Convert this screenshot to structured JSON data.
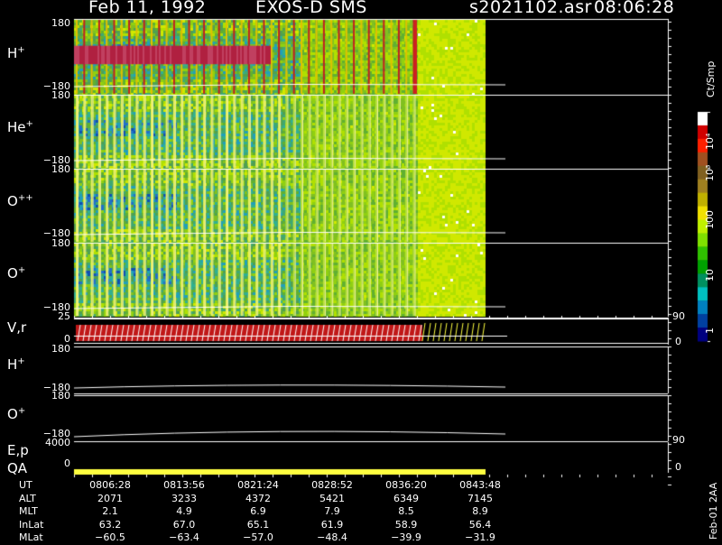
{
  "header": {
    "date": "Feb 11, 1992",
    "mission": "EXOS-D SMS",
    "file": "s2021102.asr",
    "time": "08:06:28"
  },
  "panels": [
    {
      "id": "h",
      "label": "H",
      "sup": "+",
      "top_tick": "180",
      "bottom_tick": "−180"
    },
    {
      "id": "he",
      "label": "He",
      "sup": "+",
      "top_tick": "180",
      "bottom_tick": "−180"
    },
    {
      "id": "opp",
      "label": "O",
      "sup": "++",
      "top_tick": "180",
      "bottom_tick": "−180"
    },
    {
      "id": "o",
      "label": "O",
      "sup": "+",
      "top_tick": "180",
      "bottom_tick": "−180"
    }
  ],
  "vr_panel": {
    "label": "V,r",
    "top_tick": "25",
    "bottom_tick": "0",
    "right_top": "90",
    "right_bottom": "0"
  },
  "h_line_panel": {
    "label": "H",
    "sup": "+",
    "top_tick": "180",
    "bottom_tick": "−180"
  },
  "o_line_panel": {
    "label": "O",
    "sup": "+",
    "top_tick": "180",
    "bottom_tick": "−180"
  },
  "ep_panel": {
    "label1": "E,p",
    "label2": "QA",
    "top_tick": "4000",
    "bottom_tick": "0",
    "right_top": "90",
    "right_bottom": "0"
  },
  "colorbar": {
    "unit": "Ct/Smp",
    "labels": [
      "10⁴",
      "10³",
      "100",
      "10",
      "1"
    ],
    "colors": [
      "#ffffff",
      "#d00000",
      "#ff2000",
      "#a05020",
      "#806020",
      "#a08020",
      "#c0b000",
      "#f0e000",
      "#c0f000",
      "#80e000",
      "#30c000",
      "#00a000",
      "#009060",
      "#00c0c0",
      "#0080c0",
      "#0040a0",
      "#000080"
    ]
  },
  "time_table": {
    "rows": [
      {
        "name": "UT",
        "values": [
          "0806:28",
          "0813:56",
          "0821:24",
          "0828:52",
          "0836:20",
          "0843:48"
        ]
      },
      {
        "name": "ALT",
        "values": [
          "2071",
          "3233",
          "4372",
          "5421",
          "6349",
          "7145"
        ]
      },
      {
        "name": "MLT",
        "values": [
          "2.1",
          "4.9",
          "6.9",
          "7.9",
          "8.5",
          "8.9"
        ]
      },
      {
        "name": "InLat",
        "values": [
          "63.2",
          "67.0",
          "65.1",
          "61.9",
          "58.9",
          "56.4"
        ]
      },
      {
        "name": "MLat",
        "values": [
          "−60.5",
          "−63.4",
          "−57.0",
          "−48.4",
          "−39.9",
          "−31.9"
        ]
      }
    ]
  },
  "footer_vertical": "Feb-01 2AA",
  "colors": {
    "yellow": "#ffff40",
    "red": "#d02020",
    "white": "#ffffff"
  }
}
